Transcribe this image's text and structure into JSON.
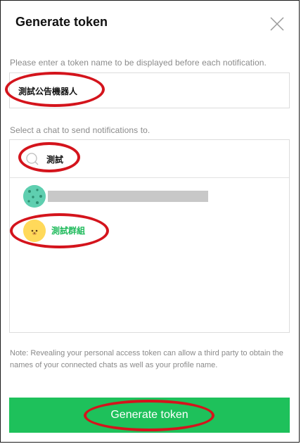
{
  "dialog": {
    "title": "Generate token",
    "close_icon": "close-icon"
  },
  "token_name": {
    "label": "Please enter a token name to be displayed before each notification.",
    "value": "測試公告機器人",
    "placeholder": ""
  },
  "chat_select": {
    "label": "Select a chat to send notifications to.",
    "search": {
      "icon": "search-icon",
      "value": "測試",
      "placeholder": ""
    },
    "items": [
      {
        "name": "",
        "avatar_icon": "green-pattern-avatar-icon",
        "redacted": true
      },
      {
        "name": "測試群組",
        "avatar_icon": "bear-avatar-icon",
        "redacted": false,
        "selected": true
      }
    ]
  },
  "note": "Note: Revealing your personal access token can allow a third party to obtain the names of your connected chats as well as your profile name.",
  "generate_button": {
    "label": "Generate token"
  },
  "colors": {
    "accent_green": "#1ec15b",
    "selected_text_green": "#1dba5a",
    "annotation_red": "#d4141c",
    "label_gray": "#8a8a8a",
    "border_gray": "#dcdcdc"
  }
}
